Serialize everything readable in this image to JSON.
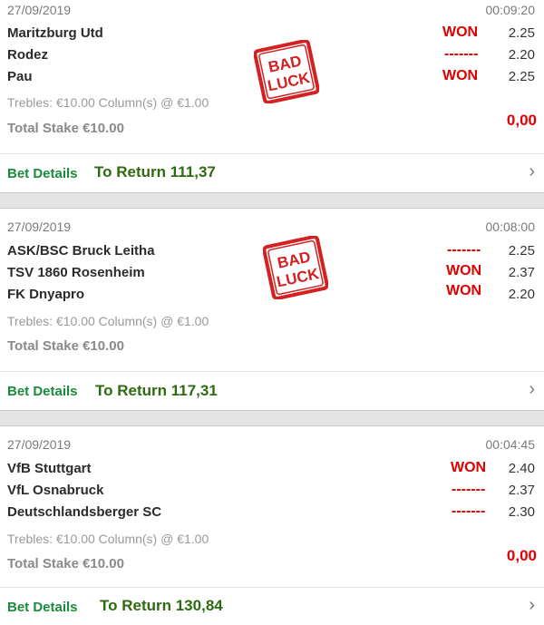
{
  "bets": [
    {
      "date": "27/09/2019",
      "time": "00:09:20",
      "selections": [
        {
          "team": "Maritzburg Utd",
          "result": "WON",
          "odds": "2.25"
        },
        {
          "team": "Rodez",
          "result": "-------",
          "odds": "2.20"
        },
        {
          "team": "Pau",
          "result": "WON",
          "odds": "2.25"
        }
      ],
      "bet_info": "Trebles: €10.00 Column(s) @ €1.00",
      "total_stake": "Total Stake €10.00",
      "return_value": "0,00",
      "details_label": "Bet Details",
      "to_return": "To Return 111,37",
      "stamp": {
        "line1": "BAD",
        "line2": "LUCK"
      }
    },
    {
      "date": "27/09/2019",
      "time": "00:08:00",
      "selections": [
        {
          "team": "ASK/BSC Bruck Leitha",
          "result": "-------",
          "odds": "2.25"
        },
        {
          "team": "TSV 1860 Rosenheim",
          "result": "WON",
          "odds": "2.37"
        },
        {
          "team": "FK Dnyapro",
          "result": "WON",
          "odds": "2.20"
        }
      ],
      "bet_info": "Trebles: €10.00 Column(s) @ €1.00",
      "total_stake": "Total Stake €10.00",
      "details_label": "Bet Details",
      "to_return": "To Return 117,31",
      "stamp": {
        "line1": "BAD",
        "line2": "LUCK"
      }
    },
    {
      "date": "27/09/2019",
      "time": "00:04:45",
      "selections": [
        {
          "team": "VfB Stuttgart",
          "result": "WON",
          "odds": "2.40"
        },
        {
          "team": "VfL Osnabruck",
          "result": "-------",
          "odds": "2.37"
        },
        {
          "team": "Deutschlandsberger SC",
          "result": "-------",
          "odds": "2.30"
        }
      ],
      "bet_info": "Trebles: €10.00 Column(s) @ €1.00",
      "total_stake": "Total Stake €10.00",
      "return_value": "0,00",
      "details_label": "Bet Details",
      "to_return": "To Return 130,84"
    }
  ],
  "icons": {
    "chevron": "chevron-right-icon",
    "stamp": "bad-luck-stamp-icon"
  },
  "colors": {
    "won": "#e00000",
    "details": "#1a8a3c",
    "to_return": "#2e6b10",
    "stamp": "#d42020"
  }
}
